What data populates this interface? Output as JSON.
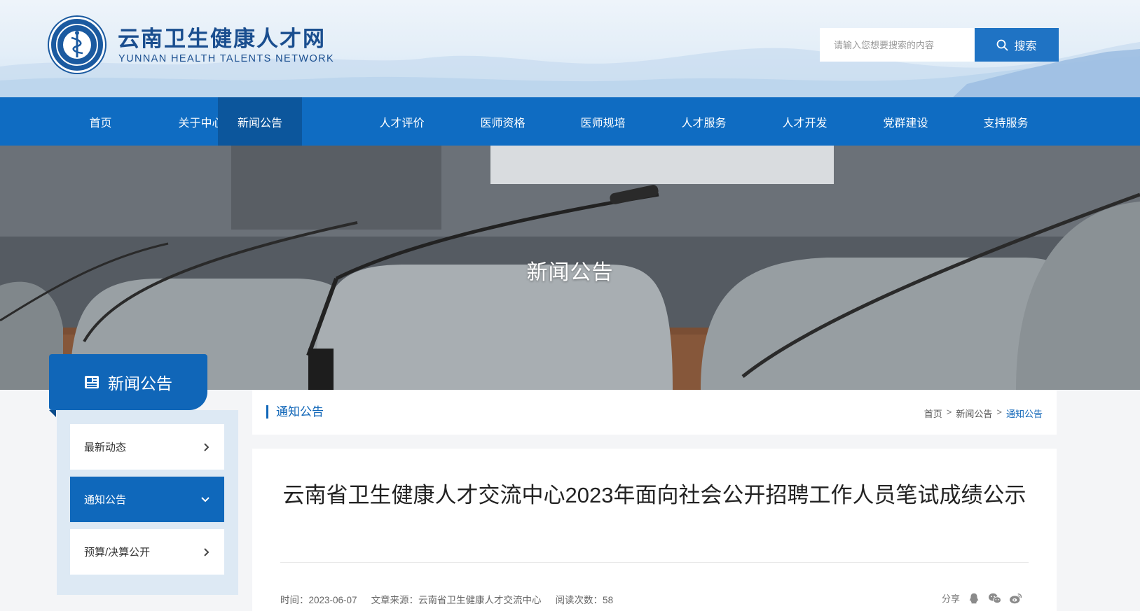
{
  "site": {
    "name_cn": "云南卫生健康人才网",
    "name_en": "YUNNAN HEALTH TALENTS NETWORK"
  },
  "search": {
    "placeholder": "请输入您想要搜索的内容",
    "button_label": "搜索"
  },
  "nav": {
    "items": [
      {
        "label": "首页"
      },
      {
        "label": "关于中心"
      },
      {
        "label": "新闻公告",
        "active": true
      },
      {
        "label": "人才评价"
      },
      {
        "label": "医师资格"
      },
      {
        "label": "医师规培"
      },
      {
        "label": "人才服务"
      },
      {
        "label": "人才开发"
      },
      {
        "label": "党群建设"
      },
      {
        "label": "支持服务"
      }
    ]
  },
  "banner": {
    "title": "新闻公告"
  },
  "sidebar": {
    "title": "新闻公告",
    "items": [
      {
        "label": "最新动态",
        "icon": "chevron-right"
      },
      {
        "label": "通知公告",
        "icon": "chevron-down",
        "active": true
      },
      {
        "label": "预算/决算公开",
        "icon": "chevron-right"
      }
    ]
  },
  "section": {
    "title": "通知公告"
  },
  "breadcrumb": {
    "items": [
      "首页",
      "新闻公告",
      "通知公告"
    ],
    "separator": ">"
  },
  "article": {
    "title": "云南省卫生健康人才交流中心2023年面向社会公开招聘工作人员笔试成绩公示",
    "time": "时间：2023-06-07",
    "source": "文章来源：云南省卫生健康人才交流中心",
    "views": "阅读次数：58",
    "share_label": "分享"
  },
  "colors": {
    "nav_bg": "#0f6cc2",
    "nav_active": "#0c569c",
    "accent": "#1066b8",
    "brand_text": "#1a4e8f"
  }
}
